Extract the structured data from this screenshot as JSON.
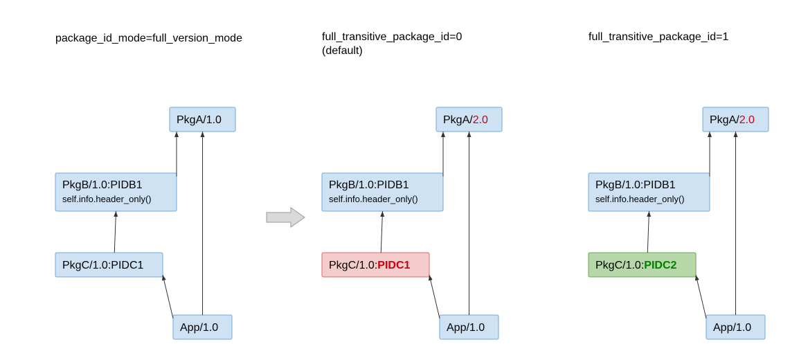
{
  "titles": {
    "p1": "package_id_mode=full_version_mode",
    "p2a": "full_transitive_package_id=0",
    "p2b": "(default)",
    "p3": "full_transitive_package_id=1"
  },
  "nodes": {
    "pkgA": {
      "pre": "PkgA/",
      "v1": "1.0",
      "v2": "2.0"
    },
    "pkgB": {
      "line1": "PkgB/1.0:PIDB1",
      "line2": "self.info.header_only()"
    },
    "pkgC": {
      "pre": "PkgC/1.0:",
      "id1": "PIDC1",
      "id2": "PIDC2"
    },
    "app": {
      "label": "App/1.0"
    }
  },
  "colors": {
    "boxFill": "#cfe2f3",
    "boxStroke": "#6fa8dc",
    "badFill": "#f4cccc",
    "badStroke": "#e06666",
    "goodFill": "#b6d7a8",
    "goodStroke": "#6aa84f",
    "red": "#cc0011",
    "green": "#008000",
    "arrowFill": "#d9d9d9",
    "arrowStroke": "#999999",
    "text": "#000"
  }
}
